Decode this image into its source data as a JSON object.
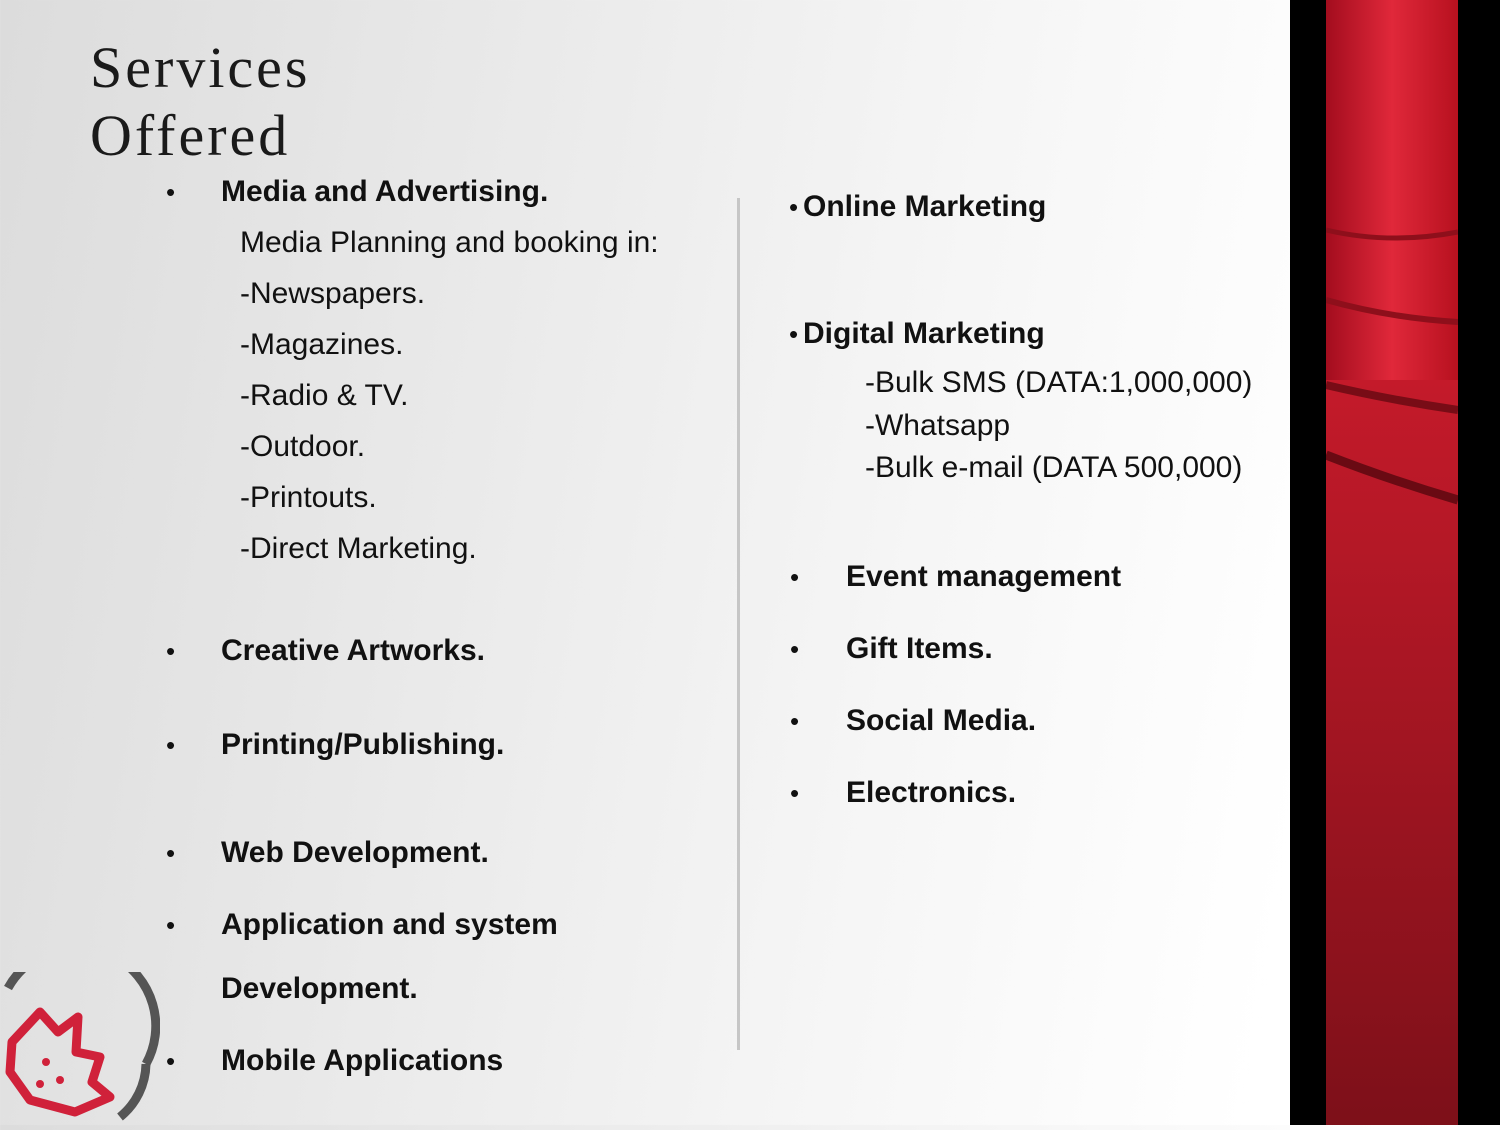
{
  "title": {
    "line1": "Services",
    "line2": "Offered"
  },
  "left": {
    "media": {
      "heading": "Media and Advertising.",
      "intro": "Media Planning  and booking in:",
      "items": [
        "-Newspapers.",
        "-Magazines.",
        "-Radio & TV.",
        "-Outdoor.",
        "-Printouts.",
        "-Direct Marketing."
      ]
    },
    "creative": "Creative Artworks.",
    "printing": "Printing/Publishing.",
    "web": "Web Development.",
    "app_line1": "Application and system",
    "app_line2": "Development.",
    "mobile": "Mobile Applications"
  },
  "right": {
    "online": "Online Marketing",
    "digital": {
      "heading": "Digital Marketing",
      "items": [
        "-Bulk SMS (DATA:1,000,000)",
        "-Whatsapp",
        "-Bulk e-mail (DATA 500,000)"
      ]
    },
    "list": [
      "Event management",
      "Gift Items.",
      "Social Media.",
      "Electronics."
    ]
  },
  "bullet_char": "•",
  "colors": {
    "accent_red": "#c8102e",
    "dark_red": "#8e1520",
    "sidebar_black": "#000000"
  },
  "icons": {
    "logo": "company-logo-icon"
  }
}
